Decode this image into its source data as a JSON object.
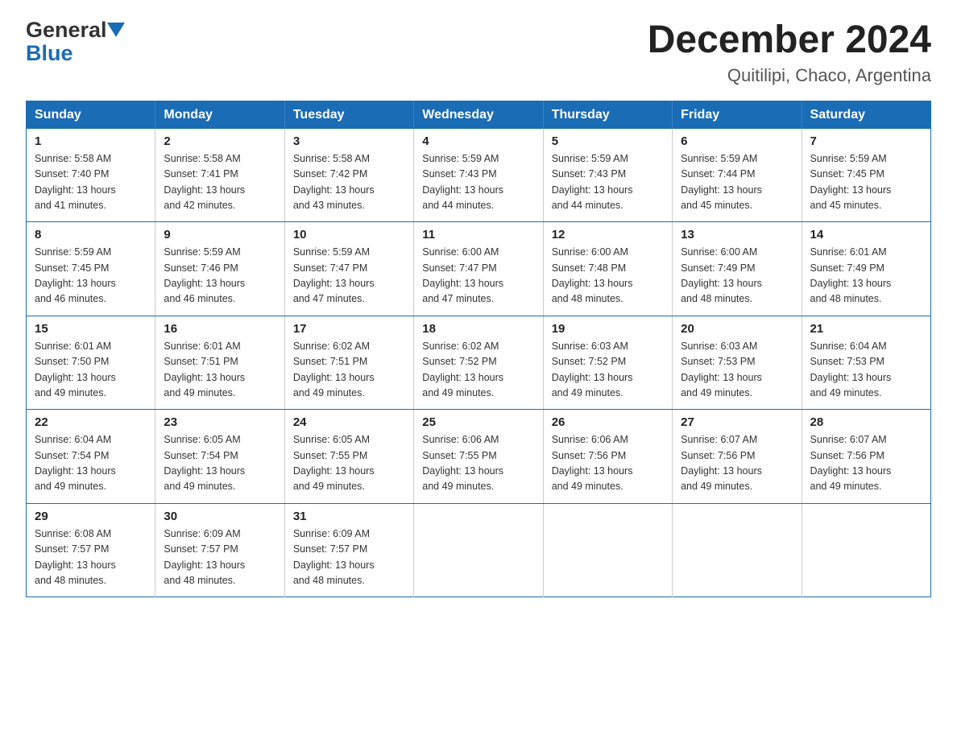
{
  "logo": {
    "general": "General",
    "blue": "Blue"
  },
  "title": "December 2024",
  "subtitle": "Quitilipi, Chaco, Argentina",
  "days_header": [
    "Sunday",
    "Monday",
    "Tuesday",
    "Wednesday",
    "Thursday",
    "Friday",
    "Saturday"
  ],
  "weeks": [
    [
      {
        "day": "1",
        "sunrise": "5:58 AM",
        "sunset": "7:40 PM",
        "daylight": "13 hours and 41 minutes."
      },
      {
        "day": "2",
        "sunrise": "5:58 AM",
        "sunset": "7:41 PM",
        "daylight": "13 hours and 42 minutes."
      },
      {
        "day": "3",
        "sunrise": "5:58 AM",
        "sunset": "7:42 PM",
        "daylight": "13 hours and 43 minutes."
      },
      {
        "day": "4",
        "sunrise": "5:59 AM",
        "sunset": "7:43 PM",
        "daylight": "13 hours and 44 minutes."
      },
      {
        "day": "5",
        "sunrise": "5:59 AM",
        "sunset": "7:43 PM",
        "daylight": "13 hours and 44 minutes."
      },
      {
        "day": "6",
        "sunrise": "5:59 AM",
        "sunset": "7:44 PM",
        "daylight": "13 hours and 45 minutes."
      },
      {
        "day": "7",
        "sunrise": "5:59 AM",
        "sunset": "7:45 PM",
        "daylight": "13 hours and 45 minutes."
      }
    ],
    [
      {
        "day": "8",
        "sunrise": "5:59 AM",
        "sunset": "7:45 PM",
        "daylight": "13 hours and 46 minutes."
      },
      {
        "day": "9",
        "sunrise": "5:59 AM",
        "sunset": "7:46 PM",
        "daylight": "13 hours and 46 minutes."
      },
      {
        "day": "10",
        "sunrise": "5:59 AM",
        "sunset": "7:47 PM",
        "daylight": "13 hours and 47 minutes."
      },
      {
        "day": "11",
        "sunrise": "6:00 AM",
        "sunset": "7:47 PM",
        "daylight": "13 hours and 47 minutes."
      },
      {
        "day": "12",
        "sunrise": "6:00 AM",
        "sunset": "7:48 PM",
        "daylight": "13 hours and 48 minutes."
      },
      {
        "day": "13",
        "sunrise": "6:00 AM",
        "sunset": "7:49 PM",
        "daylight": "13 hours and 48 minutes."
      },
      {
        "day": "14",
        "sunrise": "6:01 AM",
        "sunset": "7:49 PM",
        "daylight": "13 hours and 48 minutes."
      }
    ],
    [
      {
        "day": "15",
        "sunrise": "6:01 AM",
        "sunset": "7:50 PM",
        "daylight": "13 hours and 49 minutes."
      },
      {
        "day": "16",
        "sunrise": "6:01 AM",
        "sunset": "7:51 PM",
        "daylight": "13 hours and 49 minutes."
      },
      {
        "day": "17",
        "sunrise": "6:02 AM",
        "sunset": "7:51 PM",
        "daylight": "13 hours and 49 minutes."
      },
      {
        "day": "18",
        "sunrise": "6:02 AM",
        "sunset": "7:52 PM",
        "daylight": "13 hours and 49 minutes."
      },
      {
        "day": "19",
        "sunrise": "6:03 AM",
        "sunset": "7:52 PM",
        "daylight": "13 hours and 49 minutes."
      },
      {
        "day": "20",
        "sunrise": "6:03 AM",
        "sunset": "7:53 PM",
        "daylight": "13 hours and 49 minutes."
      },
      {
        "day": "21",
        "sunrise": "6:04 AM",
        "sunset": "7:53 PM",
        "daylight": "13 hours and 49 minutes."
      }
    ],
    [
      {
        "day": "22",
        "sunrise": "6:04 AM",
        "sunset": "7:54 PM",
        "daylight": "13 hours and 49 minutes."
      },
      {
        "day": "23",
        "sunrise": "6:05 AM",
        "sunset": "7:54 PM",
        "daylight": "13 hours and 49 minutes."
      },
      {
        "day": "24",
        "sunrise": "6:05 AM",
        "sunset": "7:55 PM",
        "daylight": "13 hours and 49 minutes."
      },
      {
        "day": "25",
        "sunrise": "6:06 AM",
        "sunset": "7:55 PM",
        "daylight": "13 hours and 49 minutes."
      },
      {
        "day": "26",
        "sunrise": "6:06 AM",
        "sunset": "7:56 PM",
        "daylight": "13 hours and 49 minutes."
      },
      {
        "day": "27",
        "sunrise": "6:07 AM",
        "sunset": "7:56 PM",
        "daylight": "13 hours and 49 minutes."
      },
      {
        "day": "28",
        "sunrise": "6:07 AM",
        "sunset": "7:56 PM",
        "daylight": "13 hours and 49 minutes."
      }
    ],
    [
      {
        "day": "29",
        "sunrise": "6:08 AM",
        "sunset": "7:57 PM",
        "daylight": "13 hours and 48 minutes."
      },
      {
        "day": "30",
        "sunrise": "6:09 AM",
        "sunset": "7:57 PM",
        "daylight": "13 hours and 48 minutes."
      },
      {
        "day": "31",
        "sunrise": "6:09 AM",
        "sunset": "7:57 PM",
        "daylight": "13 hours and 48 minutes."
      },
      null,
      null,
      null,
      null
    ]
  ],
  "labels": {
    "sunrise": "Sunrise:",
    "sunset": "Sunset:",
    "daylight": "Daylight:"
  }
}
